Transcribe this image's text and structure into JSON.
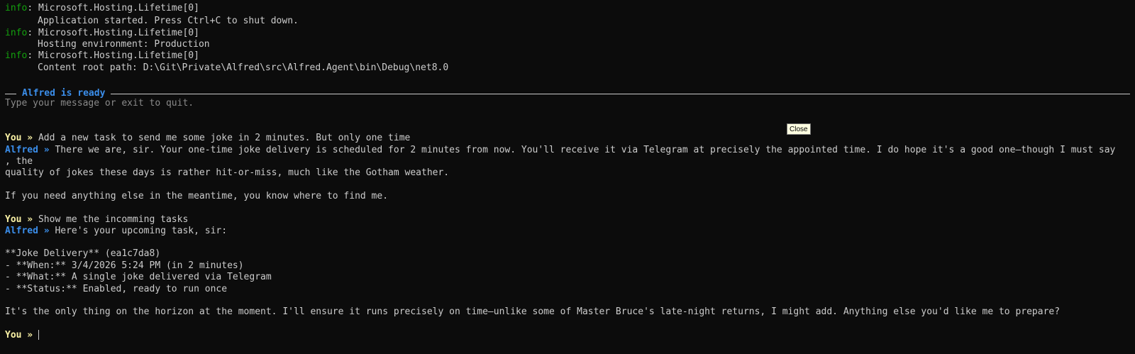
{
  "startup_log": [
    {
      "level": "info",
      "source": "Microsoft.Hosting.Lifetime[0]",
      "message": "Application started. Press Ctrl+C to shut down."
    },
    {
      "level": "info",
      "source": "Microsoft.Hosting.Lifetime[0]",
      "message": "Hosting environment: Production"
    },
    {
      "level": "info",
      "source": "Microsoft.Hosting.Lifetime[0]",
      "message": "Content root path: D:\\Git\\Private\\Alfred\\src\\Alfred.Agent\\bin\\Debug\\net8.0"
    }
  ],
  "separator": ": ",
  "banner": {
    "title": "Alfred is ready",
    "hint": "Type your message or exit to quit."
  },
  "tooltip": {
    "label": "Close"
  },
  "prompts": {
    "user": "You »",
    "assistant": "Alfred »"
  },
  "conversation": [
    {
      "user_text": "Add a new task to send me some joke in 2 minutes. But only one time"
    },
    {
      "assistant_lines": [
        "There we are, sir. Your one-time joke delivery is scheduled for 2 minutes from now. You'll receive it via Telegram at precisely the appointed time. I do hope it's a good one—though I must say",
        ", the",
        "quality of jokes these days is rather hit-or-miss, much like the Gotham weather.",
        "",
        "If you need anything else in the meantime, you know where to find me."
      ]
    },
    {
      "user_text": "Show me the incomming tasks"
    },
    {
      "assistant_lines": [
        "Here's your upcoming task, sir:",
        "",
        "**Joke Delivery** (ea1c7da8)",
        "- **When:** 3/4/2026 5:24 PM (in 2 minutes)",
        "- **What:** A single joke delivered via Telegram",
        "- **Status:** Enabled, ready to run once",
        "",
        "It's the only thing on the horizon at the moment. I'll ensure it runs precisely on time—unlike some of Master Bruce's late-night returns, I might add. Anything else you'd like me to prepare?"
      ]
    }
  ],
  "input": {
    "value": ""
  }
}
